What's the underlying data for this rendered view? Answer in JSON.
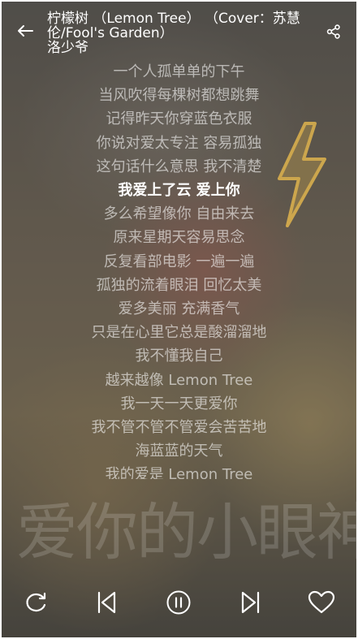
{
  "header": {
    "title": "柠檬树 （Lemon Tree） （Cover：苏慧伦/Fool's Garden）",
    "artist": "洛少爷",
    "back_icon": "arrow-left-icon",
    "share_icon": "share-icon"
  },
  "lyrics": {
    "lines": [
      "一个人孤单单的下午",
      "当风吹得每棵树都想跳舞",
      "记得昨天你穿蓝色衣服",
      "你说对爱太专注 容易孤独",
      "这句话什么意思 我不清楚",
      "我爱上了云 爱上你",
      "多么希望像你 自由来去",
      "原来星期天容易思念",
      "反复看部电影 一遍一遍",
      "孤独的流着眼泪 回忆太美",
      "爱多美丽 充满香气",
      "只是在心里它总是酸溜溜地",
      "我不懂我自己",
      "越来越像 Lemon Tree",
      "我一天一天更爱你",
      "我不管不管不管爱会苦苦地",
      "海蓝蓝的天气",
      "我的爱是 Lemon Tree"
    ],
    "active_index": 5
  },
  "background": {
    "watermark_text": "爱你的小眼神"
  },
  "controls": {
    "repeat_icon": "repeat-icon",
    "prev_icon": "skip-previous-icon",
    "play_pause_icon": "pause-circle-icon",
    "next_icon": "skip-next-icon",
    "favorite_icon": "heart-outline-icon"
  },
  "colors": {
    "text": "#ffffff",
    "lyric_inactive": "rgba(255,255,255,0.58)",
    "accent_bolt": "#f2c14e"
  }
}
